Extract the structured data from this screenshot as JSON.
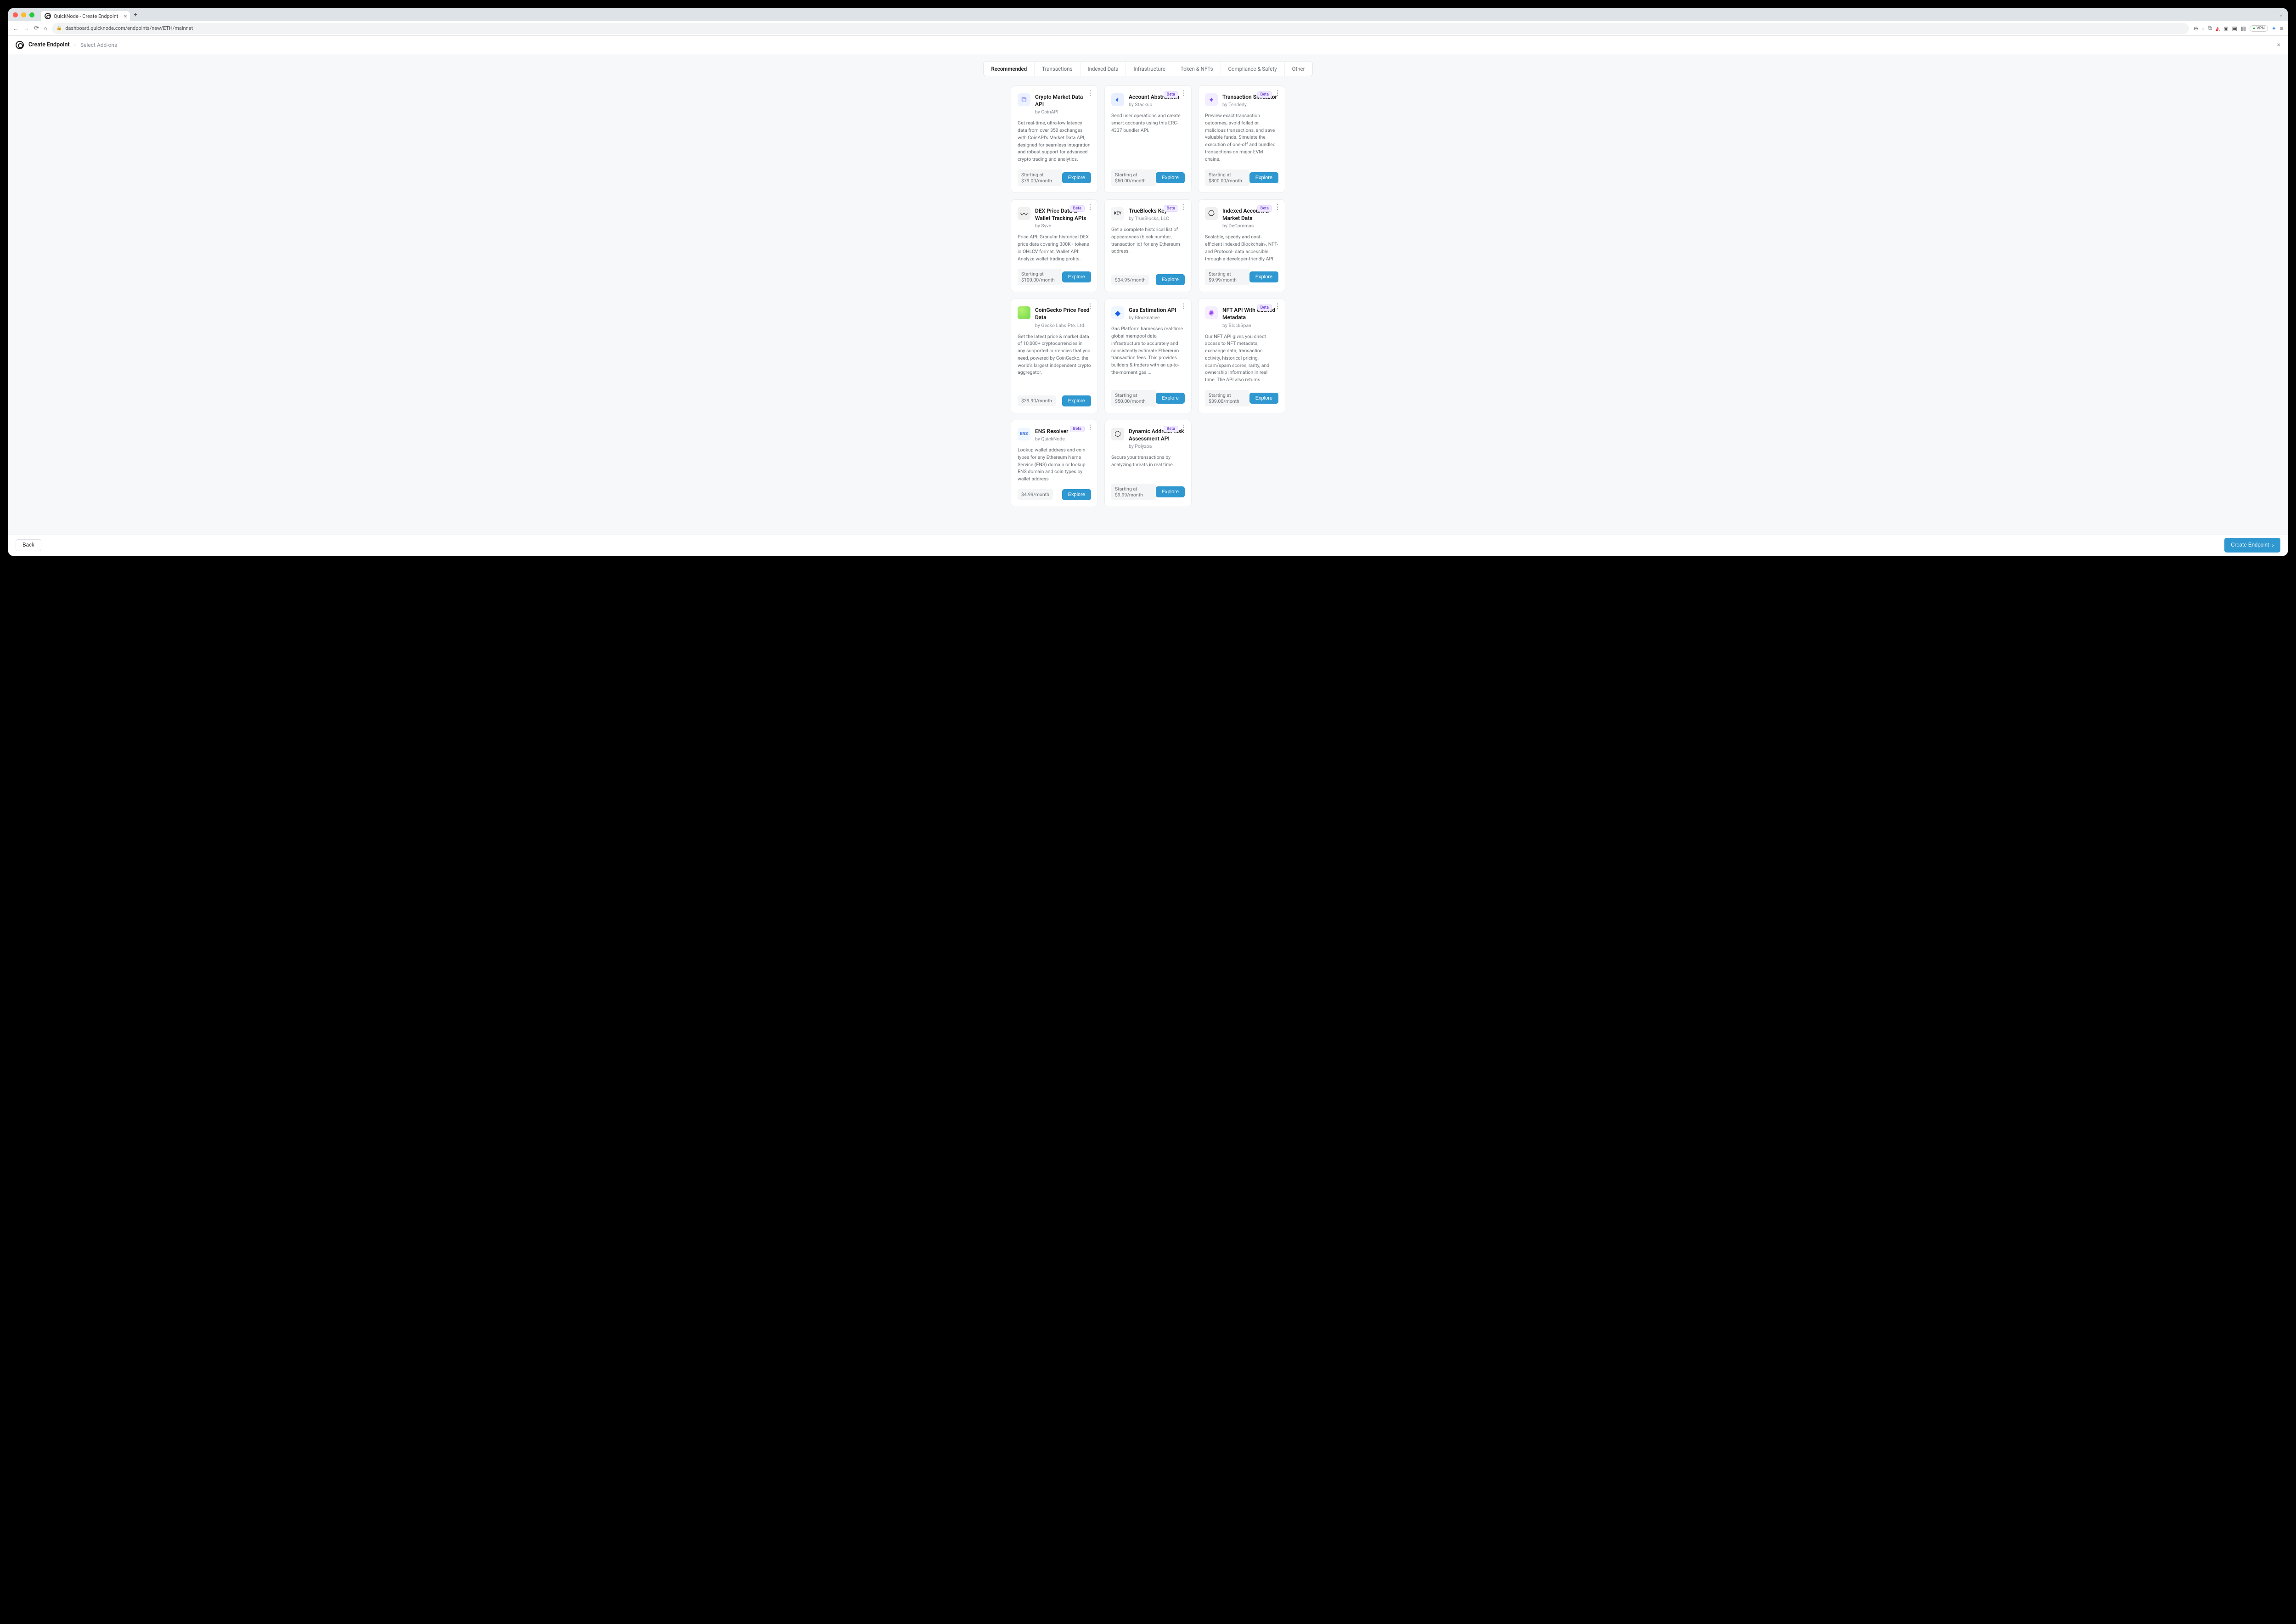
{
  "browser": {
    "tab_title": "QuickNode - Create Endpoint",
    "url": "dashboard.quicknode.com/endpoints/new/ETH/mainnet",
    "vpn_label": "VPN"
  },
  "header": {
    "title": "Create Endpoint",
    "breadcrumb": "Select Add-ons"
  },
  "tabs": [
    "Recommended",
    "Transactions",
    "Indexed Data",
    "Infrastructure",
    "Token & NFTs",
    "Compliance & Safety",
    "Other"
  ],
  "active_tab": 0,
  "beta_label": "Beta",
  "explore_label": "Explore",
  "cards": [
    {
      "title": "Crypto Market Data API",
      "by": "by CoinAPI",
      "beta": false,
      "desc": "Get real-time, ultra-low latency data from over 350 exchanges with CoinAPI's Market Data API, designed for seamless integration and robust support for advanced crypto trading and analytics.",
      "price": "Starting at $79.00/month",
      "icon": "ic-coin",
      "glyph": "⧉"
    },
    {
      "title": "Account Abstraction",
      "by": "by Stackup",
      "beta": true,
      "desc": "Send user operations and create smart accounts using this ERC-4337 bundler API.",
      "price": "Starting at $50.00/month",
      "icon": "ic-stack",
      "glyph": "◐"
    },
    {
      "title": "Transaction Simulator",
      "by": "by Tenderly",
      "beta": true,
      "desc": "Preview exact transaction outcomes, avoid failed or malicious transactions, and save valuable funds. Simulate the execution of one-off and bundled transactions on major EVM chains.",
      "price": "Starting at $800.00/month",
      "icon": "ic-tend",
      "glyph": "✦"
    },
    {
      "title": "DEX Price Data & Wallet Tracking APIs",
      "by": "by Syve",
      "beta": true,
      "desc": "Price API: Granular historical DEX price data covering 300K+ tokens in OHLCV format. Wallet API: Analyze wallet trading profits.",
      "price": "Starting at $100.00/month",
      "icon": "ic-dex",
      "glyph": "〰"
    },
    {
      "title": "TrueBlocks Key",
      "by": "by TrueBlocks, LLC",
      "beta": true,
      "desc": "Get a complete historical list of appearances (block number, transaction id) for any Ethereum address.",
      "price": "$34.95/month",
      "icon": "ic-tb",
      "glyph": "KEY"
    },
    {
      "title": "Indexed Account & Market Data",
      "by": "by DeCommas",
      "beta": true,
      "desc": "Scalable, speedy and cost-efficient indexed Blockchain-, NFT- and Protocol- data accessible through a developer-friendly API.",
      "price": "Starting at $9.99/month",
      "icon": "ic-idx",
      "glyph": "⎔"
    },
    {
      "title": "CoinGecko Price Feed Data",
      "by": "by Gecko Labs Pte. Ltd.",
      "beta": false,
      "desc": "Get the latest price & market data of 10,000+ cryptocurrencies in any supported currencies that you need, powered by CoinGecko, the world's largest independent crypto aggregator.",
      "price": "$39.90/month",
      "icon": "ic-gecko",
      "glyph": ""
    },
    {
      "title": "Gas Estimation API",
      "by": "by Blocknative",
      "beta": false,
      "desc": "Gas Platform harnesses real-time global mempool data infrastructure to accurately and consistently estimate Ethereum transaction fees. This provides builders & traders with an up-to-the-moment gas ...",
      "price": "Starting at $50.00/month",
      "icon": "ic-gas",
      "glyph": "◆"
    },
    {
      "title": "NFT API With Cached Metadata",
      "by": "by BlockSpan",
      "beta": true,
      "desc": "Our NFT API gives you direct access to NFT metadata, exchange data, transaction activity, historical pricing, scam/spam scores, rarity, and ownership information in real time. The API also returns ...",
      "price": "Starting at $39.00/month",
      "icon": "ic-nft",
      "glyph": "✺"
    },
    {
      "title": "ENS Resolver",
      "by": "by QuickNode",
      "beta": true,
      "desc": "Lookup wallet address and coin types for any Ethereum Name Service (ENS) domain or lookup ENS domain and coin types by wallet address",
      "price": "$4.99/month",
      "icon": "ic-ens",
      "glyph": "ENS"
    },
    {
      "title": "Dynamic Address Risk Assessment API",
      "by": "by Polyzoa",
      "beta": true,
      "desc": "Secure your transactions by analyzing threats in real time.",
      "price": "Starting at $9.99/month",
      "icon": "ic-poly",
      "glyph": "⬡"
    }
  ],
  "footer": {
    "back": "Back",
    "create": "Create Endpoint"
  }
}
